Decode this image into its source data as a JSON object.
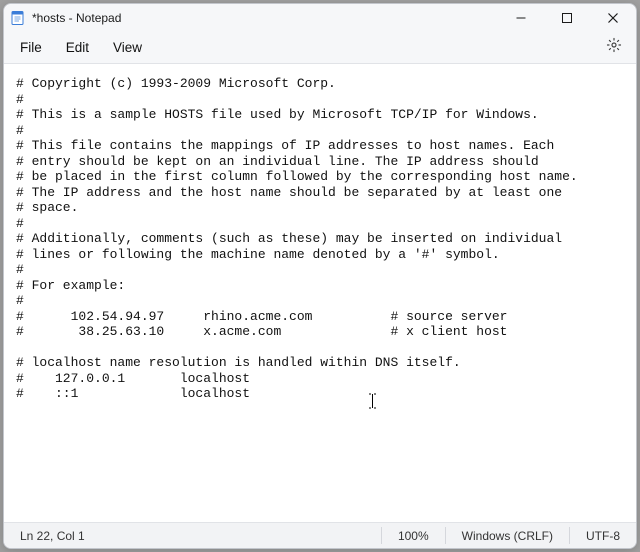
{
  "titlebar": {
    "title": "*hosts - Notepad"
  },
  "menu": {
    "file": "File",
    "edit": "Edit",
    "view": "View"
  },
  "text": "# Copyright (c) 1993-2009 Microsoft Corp.\n#\n# This is a sample HOSTS file used by Microsoft TCP/IP for Windows.\n#\n# This file contains the mappings of IP addresses to host names. Each\n# entry should be kept on an individual line. The IP address should\n# be placed in the first column followed by the corresponding host name.\n# The IP address and the host name should be separated by at least one\n# space.\n#\n# Additionally, comments (such as these) may be inserted on individual\n# lines or following the machine name denoted by a '#' symbol.\n#\n# For example:\n#\n#      102.54.94.97     rhino.acme.com          # source server\n#       38.25.63.10     x.acme.com              # x client host\n\n# localhost name resolution is handled within DNS itself.\n#    127.0.0.1       localhost\n#    ::1             localhost",
  "statusbar": {
    "position": "Ln 22, Col 1",
    "zoom": "100%",
    "lineend": "Windows (CRLF)",
    "encoding": "UTF-8"
  }
}
